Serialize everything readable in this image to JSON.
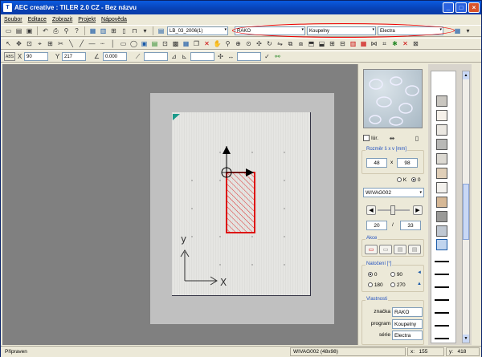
{
  "window": {
    "title": "AEC creative : TILER 2.0 CZ  - Bez názvu",
    "app_letter": "T"
  },
  "title_buttons": {
    "min": "_",
    "max": "□",
    "close": "×"
  },
  "menu": [
    "Soubor",
    "Editace",
    "Zobrazit",
    "Projekt",
    "Nápověda"
  ],
  "toolbar1": {
    "catalog": "LB_03_2006(1)",
    "manufacturer": "RAKO",
    "program": "Koupelny",
    "series": "Electra"
  },
  "toolbar3": {
    "abs_label": "ABS",
    "x_label": "X",
    "x_value": "90",
    "y_label": "Y",
    "y_value": "217",
    "angle_value": "0.000"
  },
  "canvas": {
    "axis_x": "X",
    "axis_y": "y"
  },
  "panel": {
    "flip_label": "Iür.",
    "size_section": "Rozměr š x v [mm]",
    "width": "48",
    "x_sep": "x",
    "height": "98",
    "radio_k": "K",
    "radio_o": "0",
    "tile_code": "WIVAG002",
    "slider_left": "20",
    "slider_sep": "/",
    "slider_right": "33",
    "actions_section": "Akce",
    "rotation_section": "Natočení [°]",
    "rot_options": [
      "0",
      "90",
      "180",
      "270"
    ],
    "props_section": "Vlastnosti",
    "prop_rows": [
      {
        "label": "značka",
        "value": "RAKO"
      },
      {
        "label": "program",
        "value": "Koupelny"
      },
      {
        "label": "série",
        "value": "Electra"
      }
    ]
  },
  "status": {
    "state": "Připraven",
    "tile_info": "WIVAG002 (48x98)",
    "x_label": "x:",
    "x_value": "155",
    "y_label": "y:",
    "y_value": "418"
  },
  "colors": {
    "accent_red": "#dd0000",
    "title_blue": "#0a5adf",
    "select_teal": "#1a9a8a"
  }
}
